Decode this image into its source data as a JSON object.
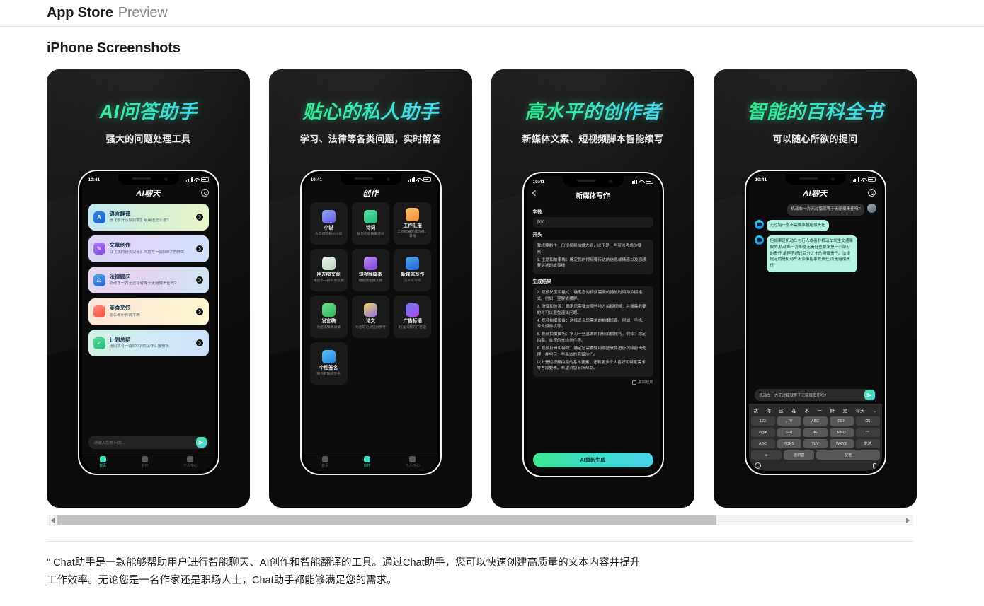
{
  "header": {
    "brand": "App Store",
    "brand_sub": "Preview"
  },
  "section": {
    "title": "iPhone Screenshots"
  },
  "statusbar": {
    "time": "10:41"
  },
  "screenshots": [
    {
      "headline": "AI问答助手",
      "subheadline": "强大的问题处理工具",
      "app_title": "AI聊天",
      "cards": [
        {
          "title": "语言翻译",
          "desc": "请【很开心见到你】用英语怎么说?"
        },
        {
          "title": "文章创作",
          "desc": "以《我的班长父亲》为题写一篇500字的作文"
        },
        {
          "title": "法律顾问",
          "desc": "机动车一方无过错就等于无赔偿责任吗?"
        },
        {
          "title": "美食烹饪",
          "desc": "怎么做小炒黄牛肉"
        },
        {
          "title": "计划总结",
          "desc": "请给我写一篇500字的工作汇报模板"
        }
      ],
      "composer_placeholder": "请输入您想问的...",
      "tabs": [
        {
          "label": "首页",
          "active": true
        },
        {
          "label": "创作",
          "active": false
        },
        {
          "label": "个人中心",
          "active": false
        }
      ]
    },
    {
      "headline": "贴心的私人助手",
      "subheadline": "学习、法律等各类问题，实时解答",
      "app_title": "创作",
      "tiles": [
        {
          "title": "小说",
          "desc": "为您撰写精彩小说"
        },
        {
          "title": "诗词",
          "desc": "替您构思精美诗词"
        },
        {
          "title": "工作汇报",
          "desc": "工作成果写成周报、日报"
        },
        {
          "title": "朋友圈文案",
          "desc": "体验不一样的朋友圈"
        },
        {
          "title": "短视频脚本",
          "desc": "短视频拍摄大纲"
        },
        {
          "title": "新媒体写作",
          "desc": "公众号写作"
        },
        {
          "title": "发言稿",
          "desc": "为您编辑演讲稿"
        },
        {
          "title": "论文",
          "desc": "为您的论文提供参考"
        },
        {
          "title": "广告标语",
          "desc": "校准同频的广告语"
        },
        {
          "title": "个性签名",
          "desc": "制作有趣的签名"
        }
      ],
      "tabs": [
        {
          "label": "首页",
          "active": false
        },
        {
          "label": "创作",
          "active": true
        },
        {
          "label": "个人中心",
          "active": false
        }
      ]
    },
    {
      "headline": "高水平的创作者",
      "subheadline": "新媒体文案、短视频脚本智能续写",
      "app_title": "新媒体写作",
      "field_label": "字数",
      "field_value": "500",
      "start_label": "开头",
      "start_text_1": "我想要制作一份短视频拍摄大纲，以下是一些可以考虑的要素：",
      "start_text_2": "1. 主题和故事线：确定您的视频要传达的信息或情感以及您想要讲述的故事线",
      "result_label": "生成结果",
      "result_lines": [
        "2. 视频长度和格式：确定您的视频需要的播放时间和拍摄格式。例如：竖屏或横屏。",
        "3. 场景和位置：确定您需要去哪些地方拍摄视频，并搜集必要的许可以避免违法问题。",
        "4. 视频拍摄设备：选择适合您需求的拍摄设备。例如：手机、专业摄像机等。",
        "5. 视频拍摄技巧：学习一些基本的视频拍摄技巧。例如：稳定拍摄、合理的光线条件等。",
        "6. 视频剪辑和特效：确定您需要使用哪些软件进行视频剪辑处理，并学习一些基本的剪辑技巧。",
        "以上是短视频拍摄的基本要素，还有更多个人喜好和特定需求等考虑要素。希望对您有所帮助。"
      ],
      "copy_label": "复制结果",
      "regenerate_label": "AI重新生成"
    },
    {
      "headline": "智能的百科全书",
      "subheadline": "可以随心所欲的提问",
      "app_title": "AI聊天",
      "messages": [
        {
          "from": "user",
          "text": "机动车一方无过错就等于无赔偿责任吗?"
        },
        {
          "from": "ai",
          "text": "无过错一般不需要承担赔偿责任"
        },
        {
          "from": "ai",
          "text": "但如果是机动车与行人或者非机动车发生交通事故的,机动车一方即便无责任也要承担一小部分的责任,承担不超过百分之十的赔偿责任。法律规定的是机动车不会承担事故责任,而是赔偿责任"
        }
      ],
      "ask_value": "机动车一方无过错就等于无赔偿责任吗?",
      "keyboard": {
        "suggestions": [
          "我",
          "你",
          "这",
          "在",
          "不",
          "一",
          "好",
          "是",
          "今天"
        ],
        "rows": [
          [
            "123",
            "。?!",
            "ABC",
            "DEF",
            "⌫"
          ],
          [
            "#@¥",
            "GHI",
            "JKL",
            "MNO",
            "^^"
          ],
          [
            "ABC",
            "PQRS",
            "TUV",
            "WXYZ",
            "发送"
          ],
          [
            "☺",
            "选拼音",
            "空格"
          ]
        ]
      }
    }
  ],
  "description": "\" Chat助手是一款能够帮助用户进行智能聊天、AI创作和智能翻译的工具。通过Chat助手，您可以快速创建高质量的文本内容并提升工作效率。无论您是一名作家还是职场人士，Chat助手都能够满足您的需求。"
}
